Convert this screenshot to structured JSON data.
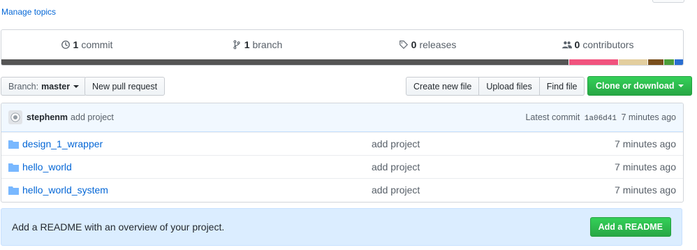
{
  "topics": {
    "label": "Manage topics"
  },
  "stats": {
    "commits": {
      "count": "1",
      "label": "commit"
    },
    "branches": {
      "count": "1",
      "label": "branch"
    },
    "releases": {
      "count": "0",
      "label": "releases"
    },
    "contributors": {
      "count": "0",
      "label": "contributors"
    }
  },
  "language_bar": [
    {
      "color": "#555555",
      "share": 0.836
    },
    {
      "color": "#f1537e",
      "share": 0.072
    },
    {
      "color": "#e3ce9e",
      "share": 0.043
    },
    {
      "color": "#7a4f1c",
      "share": 0.022
    },
    {
      "color": "#4c9e3a",
      "share": 0.015
    },
    {
      "color": "#2a6ed1",
      "share": 0.012
    }
  ],
  "toolbar": {
    "branch_key": "Branch:",
    "branch_value": "master",
    "new_pr": "New pull request",
    "create_file": "Create new file",
    "upload_files": "Upload files",
    "find_file": "Find file",
    "clone": "Clone or download"
  },
  "commit": {
    "author": "stephenm",
    "message": "add project",
    "latest_label": "Latest commit",
    "sha": "1a06d41",
    "age": "7 minutes ago"
  },
  "files": [
    {
      "name": "design_1_wrapper",
      "message": "add project",
      "age": "7 minutes ago"
    },
    {
      "name": "hello_world",
      "message": "add project",
      "age": "7 minutes ago"
    },
    {
      "name": "hello_world_system",
      "message": "add project",
      "age": "7 minutes ago"
    }
  ],
  "readme": {
    "text": "Add a README with an overview of your project.",
    "button": "Add a README"
  },
  "colors": {
    "link": "#0366d6",
    "green": "#28a745"
  }
}
